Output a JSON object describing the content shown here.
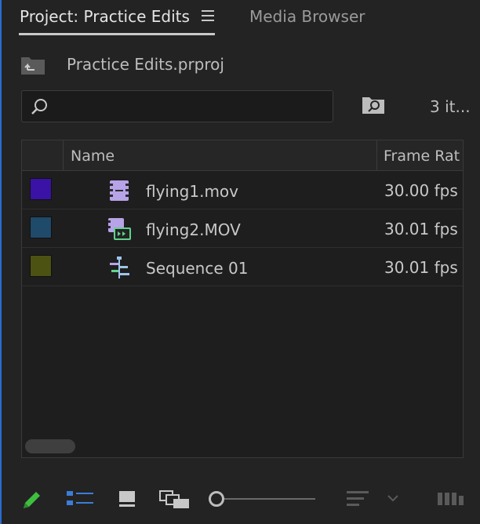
{
  "tabs": {
    "project_label": "Project: Practice Edits",
    "media_browser_label": "Media Browser"
  },
  "project": {
    "file_name": "Practice Edits.prproj",
    "item_count": "3 it..."
  },
  "search": {
    "value": "",
    "placeholder": ""
  },
  "table": {
    "columns": {
      "name": "Name",
      "frame_rate": "Frame Rat"
    },
    "rows": [
      {
        "label_color": "#3a12a6",
        "icon": "video-clip-icon",
        "name": "flying1.mov",
        "frame_rate": "30.00 fps"
      },
      {
        "label_color": "#1f4a69",
        "icon": "av-clip-icon",
        "name": "flying2.MOV",
        "frame_rate": "30.01 fps"
      },
      {
        "label_color": "#4c5212",
        "icon": "sequence-icon",
        "name": "Sequence 01",
        "frame_rate": "30.01 fps"
      }
    ]
  },
  "toolbar": {
    "icons": [
      "pencil-icon",
      "list-view-icon",
      "icon-view-icon",
      "freeform-view-icon",
      "zoom-slider",
      "sort-icon",
      "chevron-down-icon",
      "automate-to-sequence-icon"
    ]
  },
  "colors": {
    "accent": "#2b6ad2",
    "pencil": "#3fbf3f",
    "list_view_active": "#3b7dd8",
    "panel_bg": "#232323"
  }
}
